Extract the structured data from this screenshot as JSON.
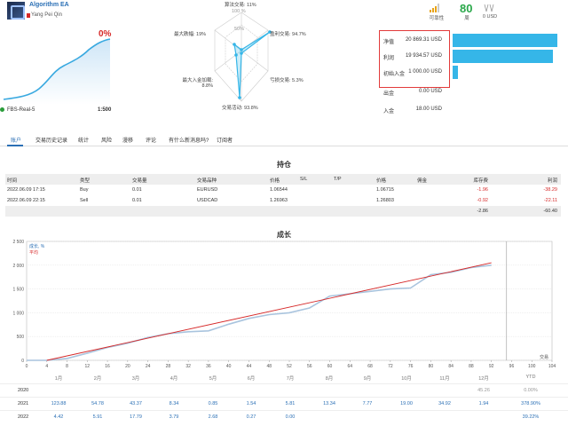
{
  "header": {
    "ea_name": "Algorithm EA",
    "author": "Yang Pei Qin",
    "growth": "0%",
    "broker": "FBS-Real-5",
    "leverage": "1:500"
  },
  "radar": {
    "labels": {
      "top": "算法交易: 11%",
      "top_sub": "100 %",
      "r1": "盈利交易: 94.7%",
      "r2": "亏损交易: 5.3%",
      "bottom": "交易活动: 93.8%",
      "l2": "最大入金加载: 8.8%",
      "l1": "最大跌幅: 19%",
      "ring": "50%"
    }
  },
  "stats_top": {
    "activity_label": "可靠性",
    "rating": "80",
    "rating_label": "周",
    "subscribers": "0 USD"
  },
  "financials": [
    {
      "label": "净值",
      "value": "20 869.31 USD",
      "bar": 1.0
    },
    {
      "label": "利润",
      "value": "19 934.57 USD",
      "bar": 0.96
    },
    {
      "label": "初始入金",
      "value": "1 000.00 USD",
      "bar": 0.05
    },
    {
      "label": "出金",
      "value": "0.00 USD",
      "bar": 0
    },
    {
      "label": "入金",
      "value": "18.00 USD",
      "bar": 0
    }
  ],
  "tabs": [
    "账户",
    "交易历史记录",
    "统计",
    "风险",
    "漫移",
    "评论",
    "有什么新消息吗?",
    "订阅者"
  ],
  "positions": {
    "title": "持仓",
    "headers": [
      "时间",
      "类型",
      "交易量",
      "交易品种",
      "价格",
      "S/L",
      "T/P",
      "价格",
      "佣金",
      "库存费",
      "利润"
    ],
    "rows": [
      [
        "2022.06.09 17:15",
        "Buy",
        "0.01",
        "EURUSD",
        "1.06544",
        "",
        "",
        "1.06715",
        "",
        "-1.96",
        "-38.29"
      ],
      [
        "2022.06.09 22:15",
        "Sell",
        "0.01",
        "USDCAD",
        "1.26963",
        "",
        "",
        "1.26803",
        "",
        "-0.92",
        "-22.11"
      ]
    ],
    "total": [
      "-2.86",
      "-60.40"
    ]
  },
  "growth": {
    "title": "成长",
    "legend_balance": "成长, %",
    "legend_trend": "平均",
    "x_axis_label": "交易"
  },
  "chart_data": {
    "type": "line",
    "xlabel": "交易",
    "ylabel": "",
    "xlim": [
      0,
      104
    ],
    "ylim": [
      0,
      2500
    ],
    "x_ticks": [
      0,
      4,
      8,
      12,
      16,
      20,
      24,
      28,
      32,
      36,
      40,
      44,
      48,
      52,
      56,
      60,
      64,
      68,
      72,
      76,
      80,
      84,
      88,
      92,
      96,
      100,
      104
    ],
    "y_ticks": [
      "0",
      "500",
      "1 000",
      "1 500",
      "2 000",
      "2 500"
    ],
    "series": [
      {
        "name": "成长, %",
        "x": [
          0,
          4,
          8,
          12,
          16,
          20,
          24,
          28,
          32,
          36,
          40,
          44,
          48,
          52,
          56,
          60,
          64,
          68,
          72,
          76,
          80,
          84,
          88,
          92
        ],
        "y": [
          0,
          0,
          40,
          150,
          270,
          360,
          480,
          560,
          600,
          620,
          760,
          880,
          960,
          1000,
          1100,
          1350,
          1400,
          1450,
          1500,
          1520,
          1800,
          1850,
          1950,
          2000
        ]
      },
      {
        "name": "平均",
        "x": [
          4,
          92
        ],
        "y": [
          0,
          2050
        ]
      }
    ]
  },
  "yearly": {
    "months": [
      "1月",
      "2月",
      "3月",
      "4月",
      "5月",
      "6月",
      "7月",
      "8月",
      "9月",
      "10月",
      "11月",
      "12月",
      "YTD"
    ],
    "rows": [
      {
        "year": "2020",
        "values": [
          "",
          "",
          "",
          "",
          "",
          "",
          "",
          "",
          "",
          "",
          "",
          "45.26",
          "0.00%"
        ]
      },
      {
        "year": "2021",
        "values": [
          "123.88",
          "54.78",
          "43.37",
          "8.34",
          "0.85",
          "1.54",
          "5.81",
          "13.34",
          "7.77",
          "19.00",
          "34.92",
          "1.94",
          "378.90%"
        ]
      },
      {
        "year": "2022",
        "values": [
          "4.42",
          "5.91",
          "17.79",
          "3.79",
          "2.68",
          "0.27",
          "0.00",
          "",
          "",
          "",
          "",
          "",
          "39.22%"
        ]
      }
    ]
  },
  "colors": {
    "accent": "#2a6fb5",
    "bar": "#35b6e8",
    "negative": "#d62828",
    "positive": "#2aa84a",
    "trend": "#d62828",
    "balance": "#a9c4de"
  }
}
